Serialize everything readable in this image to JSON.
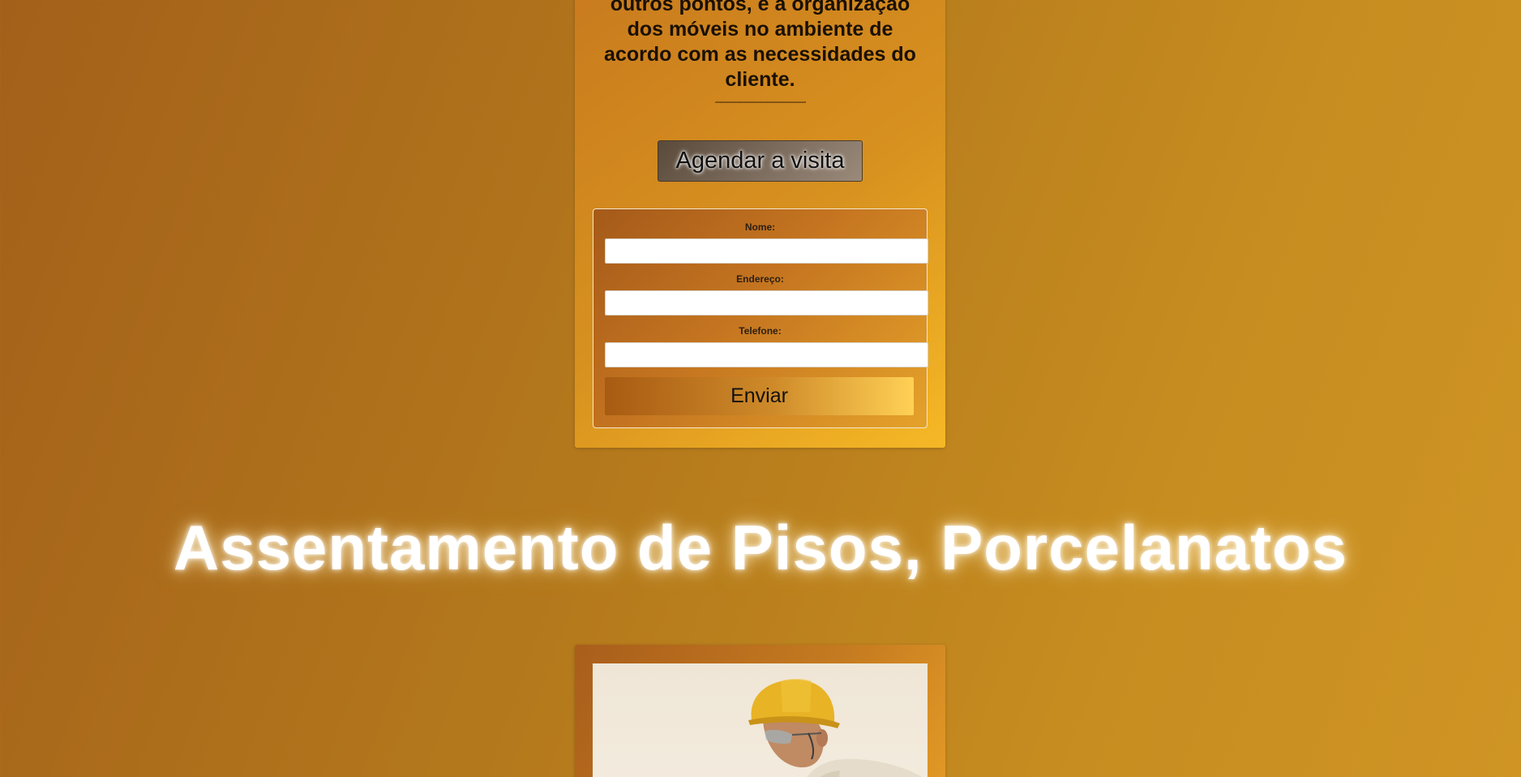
{
  "service_card": {
    "description": "outros pontos, e a organização dos móveis no ambiente de acordo com as necessidades do cliente.",
    "divider": "------------------------------------------",
    "schedule_button": "Agendar a visita",
    "form": {
      "fields": [
        {
          "label": "Nome:",
          "value": ""
        },
        {
          "label": "Endereço:",
          "value": ""
        },
        {
          "label": "Telefone:",
          "value": ""
        }
      ],
      "submit_label": "Enviar"
    }
  },
  "section": {
    "heading": "Assentamento de Pisos, Porcelanatos"
  },
  "photo": {
    "icon": "worker-photo"
  }
}
